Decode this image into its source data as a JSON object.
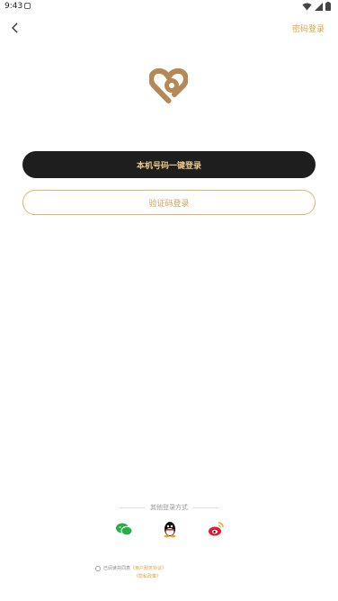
{
  "status": {
    "time": "9:43"
  },
  "header": {
    "right_link": "密码登录",
    "back_icon": "chevron-left-icon"
  },
  "brand": {
    "logo": "heart-logo",
    "color": "#b38a55"
  },
  "main": {
    "primary_button": "本机号码一键登录",
    "secondary_button": "验证码登录"
  },
  "other": {
    "label": "其他登录方式",
    "providers": [
      "wechat-icon",
      "qq-icon",
      "weibo-icon"
    ]
  },
  "agreement": {
    "prefix": "已阅读并同意",
    "link1": "《用户服务协议》",
    "link2": "《隐私政策》"
  },
  "colors": {
    "accent": "#d9a54c",
    "dark": "#1e1e1e",
    "button_text": "#e9c987"
  }
}
